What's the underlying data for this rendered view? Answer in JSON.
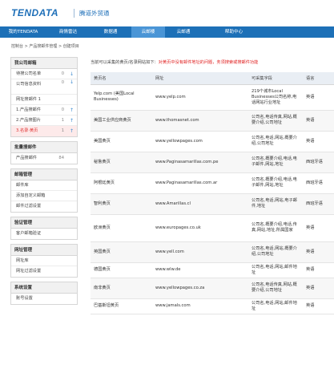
{
  "header": {
    "logo": "TENDATA",
    "subtitle": "腾道外贸通"
  },
  "nav": {
    "items": [
      {
        "label": "我的TENDATA",
        "width": 58,
        "active": false
      },
      {
        "label": "商情雷达",
        "width": 54,
        "active": false
      },
      {
        "label": "数据通",
        "width": 52,
        "active": false
      },
      {
        "label": "云邮楼",
        "width": 42,
        "active": true
      },
      {
        "label": "云邮通",
        "width": 46,
        "active": false
      },
      {
        "label": "帮助中心",
        "width": 80,
        "active": false
      }
    ]
  },
  "breadcrumb": "控制台 > 产品搜邮件管理 > 创建项目",
  "sidebar": {
    "sections": [
      {
        "title": "我公司邮箱",
        "rows": [
          {
            "label": "待搜公司名单",
            "count": "0",
            "arrow": "↓",
            "active": false
          },
          {
            "label": "公司信息资料",
            "count": "0",
            "arrow": "↓",
            "active": false,
            "two": true
          },
          {
            "label": "网址搜邮件 1",
            "count": "",
            "arrow": "",
            "active": false
          },
          {
            "label": "1.产品搜邮件",
            "count": "0",
            "arrow": "↑",
            "active": false
          },
          {
            "label": "2.产品搜图片",
            "count": "1",
            "arrow": "↑",
            "active": false
          },
          {
            "label": "3.名录·黄页",
            "count": "1",
            "arrow": "↑",
            "active": true
          }
        ]
      },
      {
        "title": "批量搜邮件",
        "rows": [
          {
            "label": "产品搜邮件",
            "count": "84",
            "arrow": "",
            "active": false
          }
        ]
      },
      {
        "title": "邮箱管理",
        "rows": [
          {
            "label": "邮件库",
            "count": "",
            "arrow": "",
            "active": false
          },
          {
            "label": "添加自定义邮箱",
            "count": "",
            "arrow": "",
            "active": false
          },
          {
            "label": "邮件过滤设置",
            "count": "",
            "arrow": "",
            "active": false
          }
        ]
      },
      {
        "title": "验证管理",
        "rows": [
          {
            "label": "客户邮箱验证",
            "count": "",
            "arrow": "",
            "active": false
          }
        ]
      },
      {
        "title": "网址管理",
        "rows": [
          {
            "label": "网址库",
            "count": "",
            "arrow": "",
            "active": false
          },
          {
            "label": "网址过滤设置",
            "count": "",
            "arrow": "",
            "active": false
          }
        ]
      },
      {
        "title": "系统设置",
        "rows": [
          {
            "label": "账号设置",
            "count": "",
            "arrow": "",
            "active": false
          }
        ]
      }
    ]
  },
  "notice": {
    "text": "当前可以采集的黄页/名录网站如下：",
    "warning": "对黄页中没有邮件地址的问题，务须搜索或搜邮件功能"
  },
  "table": {
    "columns": [
      "黄页名",
      "网址",
      "可采集字段",
      "语言"
    ],
    "rows": [
      {
        "name": "Yelp.com (美国Local Businesses)",
        "url": "www.yelp.com",
        "fields": "219个城市Local Businesses公司名称,电话网站行业地址",
        "lang": "英语"
      },
      {
        "name": "美国工业供应商黄页",
        "url": "www.thomasnet.com",
        "fields": "公司名,电话传真,网站,概要介绍,公司地址",
        "lang": "英语"
      },
      {
        "name": "美国黄页",
        "url": "www.yellowpages.com",
        "fields": "公司名,电话,网站,概要介绍,公司地址",
        "lang": "英语"
      },
      {
        "name": "秘鲁黄页",
        "url": "www.Paginasamarillas.com.pe",
        "fields": "公司名,概要介绍,电话,电子邮件,网站,地址",
        "lang": "西班牙语"
      },
      {
        "name": "阿根廷黄页",
        "url": "www.Paginasamarillas.com.ar",
        "fields": "公司名,概要介绍,电话,电子邮件,网站,地址",
        "lang": "西班牙语"
      },
      {
        "name": "智利黄页",
        "url": "www.Amarillas.cl",
        "fields": "公司名,电话,网站,电子邮件,地址",
        "lang": "西班牙语"
      },
      {
        "name": "欧洲黄页",
        "url": "www.europages.co.uk",
        "fields": "公司名,概要介绍,电话,传真,网站,地址,所属国家",
        "lang": "英语"
      },
      {
        "name": "英国黄页",
        "url": "www.yell.com",
        "fields": "公司名,电话,网站,概要介绍,公司地址",
        "lang": "英语"
      },
      {
        "name": "德国黄页",
        "url": "www.wlw.de",
        "fields": "公司名,电话,网站,邮件地址",
        "lang": "英语"
      },
      {
        "name": "南非黄页",
        "url": "www.yellowpages.co.za",
        "fields": "公司名,电话传真,网站,概要介绍,公司地址",
        "lang": "英语"
      },
      {
        "name": "巴基斯坦黄页",
        "url": "www.jamals.com",
        "fields": "公司名,电话,网站,邮件地址",
        "lang": "英语"
      }
    ]
  }
}
